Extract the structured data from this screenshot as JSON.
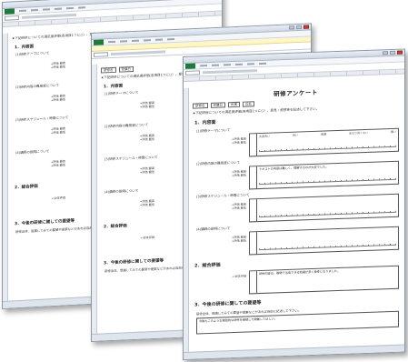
{
  "survey": {
    "title": "研修アンケート",
    "instruction": "★下記研修についての満足度評価(各項目1つに○）、意見・感想等を記述して下さい。",
    "header_labels": [
      "研修名",
      "受講日",
      "所属",
      "氏名"
    ],
    "sections": [
      {
        "label": "1．内容面"
      },
      {
        "label": "2．総合評価"
      },
      {
        "label": "3．今後の研修に関しての要望等"
      }
    ],
    "questions": [
      {
        "label": "(1)研修テーマについて",
        "answer": ""
      },
      {
        "label": "(2)研修内容の難易度について",
        "answer": "テキストの内容は難しく、理解するのが大変でした。"
      },
      {
        "label": "(3)研修スケジュール・時間について",
        "answer": ""
      },
      {
        "label": "(4)講師の説明について",
        "answer": ""
      }
    ],
    "overall": {
      "label": "←全体評価",
      "answer": "研修内容は、職場で活用できる知識が多く参考になりました。"
    },
    "scale_labels": [
      "大変良い",
      "良い",
      "普通",
      "あまり良くない",
      "悪い"
    ],
    "legend_lines": [
      "→評価 最高",
      "→評価 最低"
    ],
    "request_prompt": "研修全体、受講してみての要望や提案などがあれば自由に記述して下さい。",
    "request_text": "今後もこのような実践的な研修を継続して開催してほしい。"
  }
}
